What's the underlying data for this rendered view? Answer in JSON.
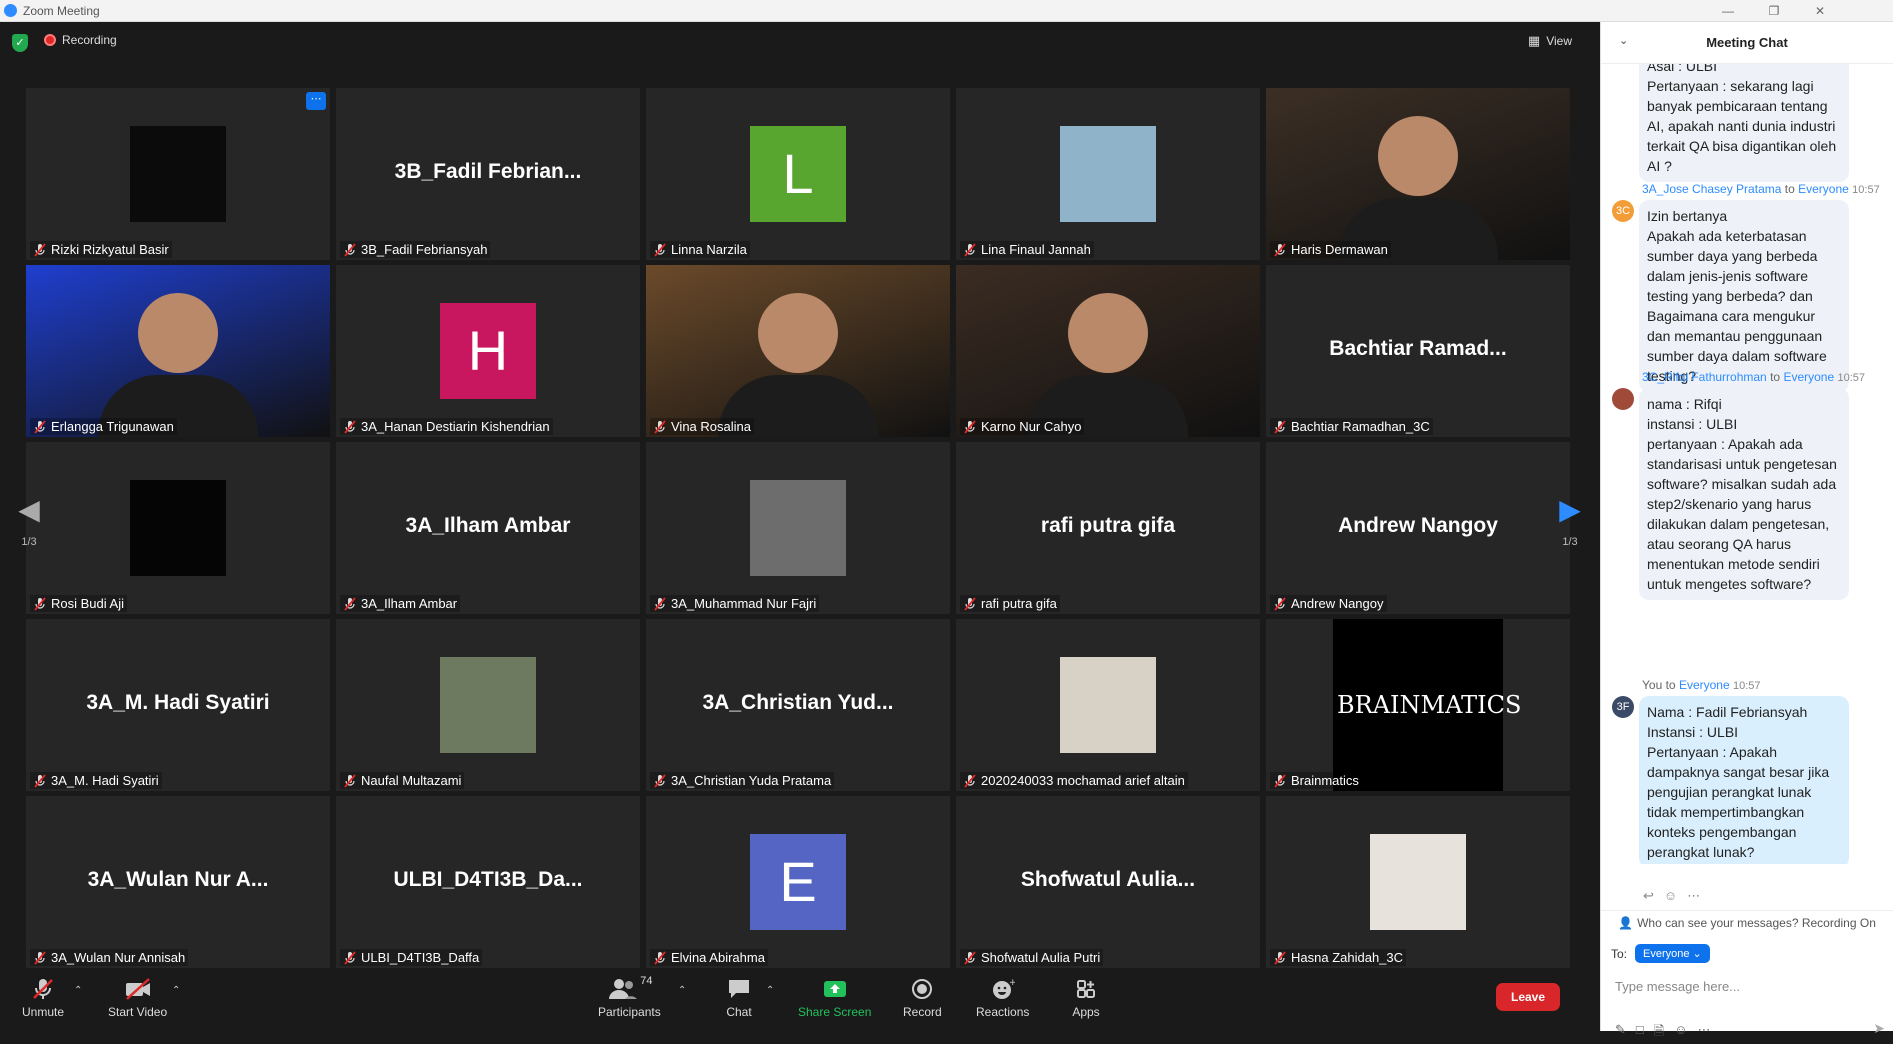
{
  "window": {
    "title": "Zoom Meeting"
  },
  "topbar": {
    "recording": "Recording",
    "view": "View"
  },
  "tiles": [
    {
      "name": "Rizki Rizkyatul Basir",
      "display": "avatar",
      "color": "#0b0b0b",
      "avatar": "logo-r"
    },
    {
      "name": "3B_Fadil Febriansyah",
      "display": "text",
      "big": "3B_Fadil  Febrian..."
    },
    {
      "name": "Linna Narzila",
      "display": "letter",
      "letter": "L",
      "color": "#58a52f"
    },
    {
      "name": "Lina Finaul Jannah",
      "display": "avatar",
      "color": "#8fb3c8",
      "avatar": "photo"
    },
    {
      "name": "Haris Dermawan",
      "display": "video",
      "color": "#3c2f25",
      "active": true
    },
    {
      "name": "Erlangga Trigunawan",
      "display": "video",
      "color": "#1f3fcf"
    },
    {
      "name": "3A_Hanan Destiarin Kishendrian",
      "display": "letter",
      "letter": "H",
      "color": "#c8175e"
    },
    {
      "name": "Vina Rosalina",
      "display": "video",
      "color": "#6b4a2a"
    },
    {
      "name": "Karno Nur Cahyo",
      "display": "video",
      "color": "#3b2c22"
    },
    {
      "name": "Bachtiar Ramadhan_3C",
      "display": "text",
      "big": "Bachtiar  Ramad..."
    },
    {
      "name": "Rosi Budi Aji",
      "display": "avatar",
      "color": "#050505",
      "avatar": "logo-dark"
    },
    {
      "name": "3A_Ilham Ambar",
      "display": "text",
      "big": "3A_Ilham Ambar"
    },
    {
      "name": "3A_Muhammad Nur Fajri",
      "display": "avatar",
      "color": "#6d6d6d",
      "avatar": "photo"
    },
    {
      "name": "rafi putra gifa",
      "display": "text",
      "big": "rafi putra gifa"
    },
    {
      "name": "Andrew Nangoy",
      "display": "text",
      "big": "Andrew Nangoy"
    },
    {
      "name": "3A_M. Hadi Syatiri",
      "display": "text",
      "big": "3A_M. Hadi Syatiri"
    },
    {
      "name": "Naufal Multazami",
      "display": "avatar",
      "color": "#6e7a60",
      "avatar": "photo"
    },
    {
      "name": "3A_Christian Yuda Pratama",
      "display": "text",
      "big": "3A_Christian  Yud..."
    },
    {
      "name": "2020240033 mochamad arief altain",
      "display": "avatar",
      "color": "#d8d2c6",
      "avatar": "photo"
    },
    {
      "name": "Brainmatics",
      "display": "logo",
      "logo": "BRAINMATICS"
    },
    {
      "name": "3A_Wulan Nur Annisah",
      "display": "text",
      "big": "3A_Wulan  Nur  A..."
    },
    {
      "name": "ULBI_D4TI3B_Daffa",
      "display": "text",
      "big": "ULBI_D4TI3B_Da..."
    },
    {
      "name": "Elvina Abirahma",
      "display": "letter",
      "letter": "E",
      "color": "#5565c4"
    },
    {
      "name": "Shofwatul Aulia Putri",
      "display": "text",
      "big": "Shofwatul  Aulia..."
    },
    {
      "name": "Hasna Zahidah_3C",
      "display": "avatar",
      "color": "#e8e2dc",
      "avatar": "photo"
    }
  ],
  "pager": {
    "left": "1/3",
    "right": "1/3"
  },
  "toolbar": {
    "unmute": "Unmute",
    "start_video": "Start Video",
    "participants": "Participants",
    "participants_count": "74",
    "chat": "Chat",
    "share_screen": "Share Screen",
    "record": "Record",
    "reactions": "Reactions",
    "apps": "Apps",
    "leave": "Leave"
  },
  "chat": {
    "title": "Meeting Chat",
    "messages": [
      {
        "text": "Asal : ULBI\nPertanyaan : sekarang lagi banyak pembicaraan tentang AI, apakah nanti dunia industri terkait QA bisa digantikan oleh AI ?"
      },
      {
        "sender": "3A_Jose Chasey Pratama",
        "to_word": "to",
        "to": "Everyone",
        "time": "10:57",
        "initials": "3C",
        "avatar_color": "#f29d38",
        "text": "Izin bertanya\nApakah ada keterbatasan sumber daya yang berbeda dalam jenis-jenis software testing yang berbeda? dan Bagaimana cara mengukur dan memantau penggunaan sumber daya dalam software testing?"
      },
      {
        "sender": "3C_Rifqi Fathurrohman",
        "to_word": "to",
        "to": "Everyone",
        "time": "10:57",
        "initials": "",
        "avatar_color": "#a04a3a",
        "text": "nama : Rifqi\ninstansi : ULBI\npertanyaan : Apakah ada standarisasi untuk pengetesan software? misalkan sudah ada step2/skenario yang harus dilakukan dalam pengetesan, atau seorang QA harus menentukan metode sendiri untuk mengetes software?"
      },
      {
        "sender": "You",
        "to_word": "to",
        "to": "Everyone",
        "time": "10:57",
        "initials": "3F",
        "avatar_color": "#3b4a66",
        "text": "Nama : Fadil Febriansyah\nInstansi : ULBI\nPertanyaan : Apakah dampaknya sangat besar jika pengujian perangkat lunak tidak mempertimbangkan konteks pengembangan perangkat lunak?"
      }
    ],
    "notice": "Who can see your messages? Recording On",
    "to_label": "To:",
    "recipient": "Everyone",
    "placeholder": "Type message here..."
  }
}
